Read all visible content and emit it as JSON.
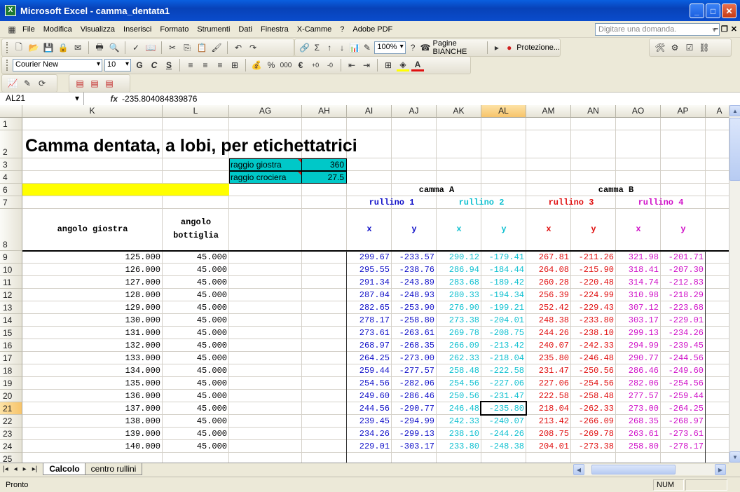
{
  "window": {
    "title": "Microsoft Excel - camma_dentata1",
    "icon": "excel-icon"
  },
  "menu": [
    "File",
    "Modifica",
    "Visualizza",
    "Inserisci",
    "Formato",
    "Strumenti",
    "Dati",
    "Finestra",
    "X-Camme",
    "?",
    "Adobe PDF"
  ],
  "help": {
    "placeholder": "Digitare una domanda."
  },
  "toolbar": {
    "zoom": "100%",
    "pagine": "Pagine BIANCHE",
    "protezione": "Protezione...",
    "font": "Courier New",
    "size": "10",
    "bold": "G",
    "italic": "C",
    "underline": "S",
    "percent": "%",
    "thousands": "000",
    "euro": "€"
  },
  "formula": {
    "cell": "AL21",
    "fx": "fx",
    "value": "-235.804084839876"
  },
  "columns": [
    "K",
    "L",
    "AG",
    "AH",
    "AI",
    "AJ",
    "AK",
    "AL",
    "AM",
    "AN",
    "AO",
    "AP",
    "A"
  ],
  "rows": [
    "1",
    "2",
    "3",
    "4",
    "6",
    "7",
    "8",
    "9",
    "10",
    "11",
    "12",
    "13",
    "14",
    "15",
    "16",
    "17",
    "18",
    "19",
    "20",
    "21",
    "22",
    "23",
    "24",
    "25"
  ],
  "sheet": {
    "title": "Camma dentata, a lobi, per etichettatrici",
    "params": [
      {
        "label": "raggio giostra",
        "value": "360"
      },
      {
        "label": "raggio crociera",
        "value": "27.5"
      }
    ],
    "camma_a": "camma A",
    "camma_b": "camma B",
    "rulli": [
      "rullino 1",
      "rullino 2",
      "rullino 3",
      "rullino 4"
    ],
    "angolo_giostra": "angolo giostra",
    "angolo_bottiglia_1": "angolo",
    "angolo_bottiglia_2": "bottiglia",
    "xy": [
      "x",
      "y",
      "x",
      "y",
      "x",
      "y",
      "x",
      "y"
    ],
    "data": [
      [
        "125.000",
        "45.000",
        "299.67",
        "-233.57",
        "290.12",
        "-179.41",
        "267.81",
        "-211.26",
        "321.98",
        "-201.71"
      ],
      [
        "126.000",
        "45.000",
        "295.55",
        "-238.76",
        "286.94",
        "-184.44",
        "264.08",
        "-215.90",
        "318.41",
        "-207.30"
      ],
      [
        "127.000",
        "45.000",
        "291.34",
        "-243.89",
        "283.68",
        "-189.42",
        "260.28",
        "-220.48",
        "314.74",
        "-212.83"
      ],
      [
        "128.000",
        "45.000",
        "287.04",
        "-248.93",
        "280.33",
        "-194.34",
        "256.39",
        "-224.99",
        "310.98",
        "-218.29"
      ],
      [
        "129.000",
        "45.000",
        "282.65",
        "-253.90",
        "276.90",
        "-199.21",
        "252.42",
        "-229.43",
        "307.12",
        "-223.68"
      ],
      [
        "130.000",
        "45.000",
        "278.17",
        "-258.80",
        "273.38",
        "-204.01",
        "248.38",
        "-233.80",
        "303.17",
        "-229.01"
      ],
      [
        "131.000",
        "45.000",
        "273.61",
        "-263.61",
        "269.78",
        "-208.75",
        "244.26",
        "-238.10",
        "299.13",
        "-234.26"
      ],
      [
        "132.000",
        "45.000",
        "268.97",
        "-268.35",
        "266.09",
        "-213.42",
        "240.07",
        "-242.33",
        "294.99",
        "-239.45"
      ],
      [
        "133.000",
        "45.000",
        "264.25",
        "-273.00",
        "262.33",
        "-218.04",
        "235.80",
        "-246.48",
        "290.77",
        "-244.56"
      ],
      [
        "134.000",
        "45.000",
        "259.44",
        "-277.57",
        "258.48",
        "-222.58",
        "231.47",
        "-250.56",
        "286.46",
        "-249.60"
      ],
      [
        "135.000",
        "45.000",
        "254.56",
        "-282.06",
        "254.56",
        "-227.06",
        "227.06",
        "-254.56",
        "282.06",
        "-254.56"
      ],
      [
        "136.000",
        "45.000",
        "249.60",
        "-286.46",
        "250.56",
        "-231.47",
        "222.58",
        "-258.48",
        "277.57",
        "-259.44"
      ],
      [
        "137.000",
        "45.000",
        "244.56",
        "-290.77",
        "246.48",
        "-235.80",
        "218.04",
        "-262.33",
        "273.00",
        "-264.25"
      ],
      [
        "138.000",
        "45.000",
        "239.45",
        "-294.99",
        "242.33",
        "-240.07",
        "213.42",
        "-266.09",
        "268.35",
        "-268.97"
      ],
      [
        "139.000",
        "45.000",
        "234.26",
        "-299.13",
        "238.10",
        "-244.26",
        "208.75",
        "-269.78",
        "263.61",
        "-273.61"
      ],
      [
        "140.000",
        "45.000",
        "229.01",
        "-303.17",
        "233.80",
        "-248.38",
        "204.01",
        "-273.38",
        "258.80",
        "-278.17"
      ]
    ]
  },
  "tabs": [
    "Calcolo",
    "centro rullini"
  ],
  "status": {
    "left": "Pronto",
    "num": "NUM"
  },
  "colors": {
    "blue": "#1010c8",
    "cyan": "#10c0d0",
    "red": "#e01010",
    "magenta": "#d010c8",
    "yellow": "#ffff00",
    "teal": "#00c8c8"
  }
}
